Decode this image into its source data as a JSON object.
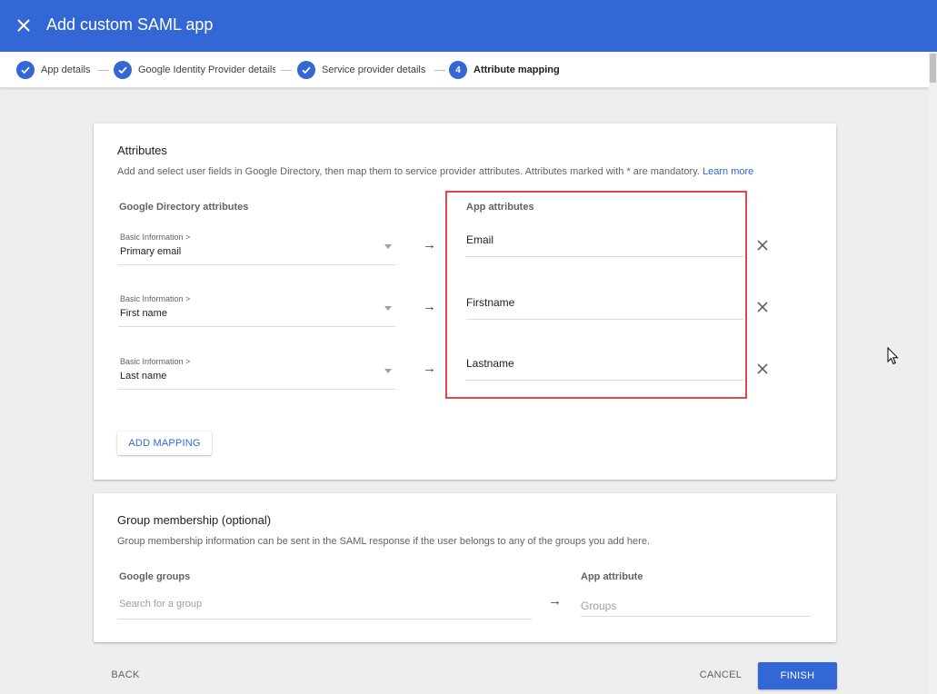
{
  "header": {
    "title": "Add custom SAML app",
    "close_icon": "close-icon",
    "bar_color": "#3367d6"
  },
  "stepper": {
    "steps": [
      {
        "label": "App details",
        "state": "done"
      },
      {
        "label": "Google Identity Provider details",
        "state": "done"
      },
      {
        "label": "Service provider details",
        "state": "done"
      },
      {
        "label": "Attribute mapping",
        "state": "active",
        "number": "4"
      }
    ]
  },
  "attributes": {
    "title": "Attributes",
    "description": "Add and select user fields in Google Directory, then map them to service provider attributes. Attributes marked with * are mandatory.",
    "learn_more": "Learn more",
    "col_google": "Google Directory attributes",
    "col_app": "App attributes",
    "mappings": [
      {
        "category": "Basic Information >",
        "field": "Primary email",
        "app_value": "Email"
      },
      {
        "category": "Basic Information >",
        "field": "First name",
        "app_value": "Firstname"
      },
      {
        "category": "Basic Information >",
        "field": "Last name",
        "app_value": "Lastname"
      }
    ],
    "arrow": "→",
    "add_mapping": "ADD MAPPING",
    "highlight_color": "#e0474c"
  },
  "group": {
    "title": "Group membership (optional)",
    "description": "Group membership information can be sent in the SAML response if the user belongs to any of the groups you add here.",
    "col_groups": "Google groups",
    "col_attr": "App attribute",
    "search_placeholder": "Search for a group",
    "attr_placeholder": "Groups",
    "arrow": "→"
  },
  "footer": {
    "back": "BACK",
    "cancel": "CANCEL",
    "finish": "FINISH"
  }
}
